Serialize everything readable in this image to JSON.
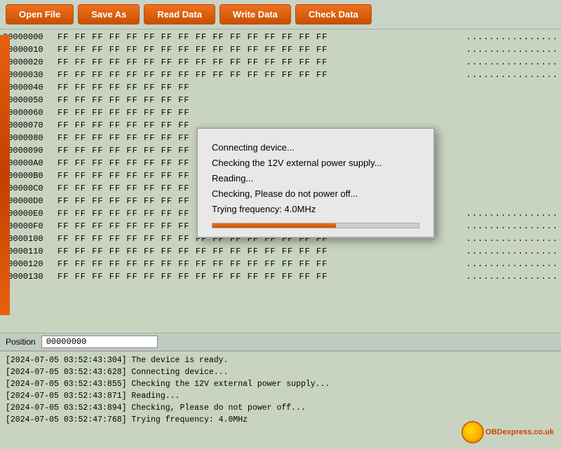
{
  "toolbar": {
    "open_file": "Open File",
    "save_as": "Save As",
    "read_data": "Read Data",
    "write_data": "Write Data",
    "check_data": "Check Data"
  },
  "hex_rows": [
    {
      "addr": "00000000",
      "bytes": "FF FF FF FF FF FF FF FF  FF FF FF FF FF FF FF FF",
      "ascii": "................"
    },
    {
      "addr": "00000010",
      "bytes": "FF FF FF FF FF FF FF FF  FF FF FF FF FF FF FF FF",
      "ascii": "................"
    },
    {
      "addr": "00000020",
      "bytes": "FF FF FF FF FF FF FF FF  FF FF FF FF FF FF FF FF",
      "ascii": "................"
    },
    {
      "addr": "00000030",
      "bytes": "FF FF FF FF FF FF FF FF  FF FF FF FF FF FF FF FF",
      "ascii": "................"
    },
    {
      "addr": "00000040",
      "bytes": "FF FF FF FF FF FF FF FF",
      "ascii": ""
    },
    {
      "addr": "00000050",
      "bytes": "FF FF FF FF FF FF FF FF",
      "ascii": ""
    },
    {
      "addr": "00000060",
      "bytes": "FF FF FF FF FF FF FF FF",
      "ascii": ""
    },
    {
      "addr": "00000070",
      "bytes": "FF FF FF FF FF FF FF FF",
      "ascii": ""
    },
    {
      "addr": "00000080",
      "bytes": "FF FF FF FF FF FF FF FF",
      "ascii": ""
    },
    {
      "addr": "00000090",
      "bytes": "FF FF FF FF FF FF FF FF",
      "ascii": ""
    },
    {
      "addr": "000000A0",
      "bytes": "FF FF FF FF FF FF FF FF",
      "ascii": ""
    },
    {
      "addr": "000000B0",
      "bytes": "FF FF FF FF FF FF FF FF",
      "ascii": ""
    },
    {
      "addr": "000000C0",
      "bytes": "FF FF FF FF FF FF FF FF",
      "ascii": ""
    },
    {
      "addr": "000000D0",
      "bytes": "FF FF FF FF FF FF FF FF",
      "ascii": ""
    },
    {
      "addr": "000000E0",
      "bytes": "FF FF FF FF FF FF FF FF  FF FF FF FF FF FF FF FF",
      "ascii": "................"
    },
    {
      "addr": "000000F0",
      "bytes": "FF FF FF FF FF FF FF FF  FF FF FF FF FF FF FF FF",
      "ascii": "................"
    },
    {
      "addr": "00000100",
      "bytes": "FF FF FF FF FF FF FF FF  FF FF FF FF FF FF FF FF",
      "ascii": "................"
    },
    {
      "addr": "00000110",
      "bytes": "FF FF FF FF FF FF FF FF  FF FF FF FF FF FF FF FF",
      "ascii": "................"
    },
    {
      "addr": "00000120",
      "bytes": "FF FF FF FF FF FF FF FF  FF FF FF FF FF FF FF FF",
      "ascii": "................"
    },
    {
      "addr": "00000130",
      "bytes": "FF FF FF FF FF FF FF FF  FF FF FF FF FF FF FF FF",
      "ascii": "................"
    }
  ],
  "position": {
    "label": "Position",
    "value": "00000000"
  },
  "popup": {
    "lines": [
      "Connecting device...",
      "Checking the 12V external power supply...",
      "Reading...",
      "Checking, Please do not power off...",
      "Trying frequency: 4.0MHz"
    ]
  },
  "log": {
    "lines": [
      "[2024-07-05 03:52:43:304] The device is ready.",
      "[2024-07-05 03:52:43:628] Connecting device...",
      "[2024-07-05 03:52:43:855] Checking the 12V external power supply...",
      "[2024-07-05 03:52:43:871] Reading...",
      "[2024-07-05 03:52:43:894] Checking, Please do not power off...",
      "[2024-07-05 03:52:47:768] Trying frequency: 4.0MHz"
    ]
  },
  "obd_logo": {
    "text": "OBDexpress.co.uk"
  }
}
